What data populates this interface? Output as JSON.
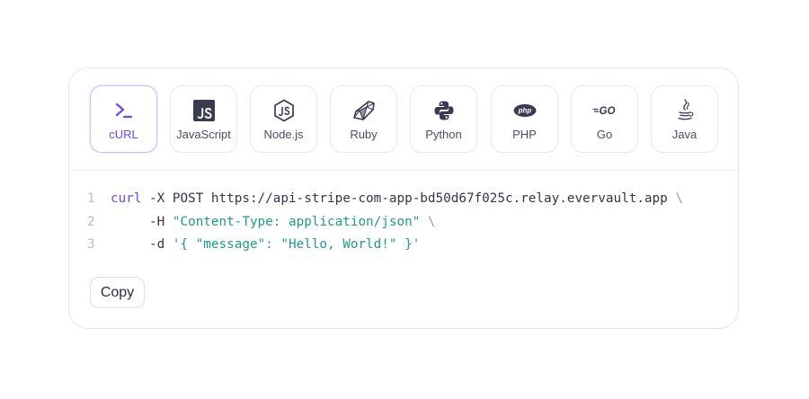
{
  "tabs": [
    {
      "label": "cURL",
      "icon": "terminal-icon",
      "active": true
    },
    {
      "label": "JavaScript",
      "icon": "javascript-icon",
      "active": false
    },
    {
      "label": "Node.js",
      "icon": "nodejs-icon",
      "active": false
    },
    {
      "label": "Ruby",
      "icon": "ruby-icon",
      "active": false
    },
    {
      "label": "Python",
      "icon": "python-icon",
      "active": false
    },
    {
      "label": "PHP",
      "icon": "php-icon",
      "active": false
    },
    {
      "label": "Go",
      "icon": "go-icon",
      "active": false
    },
    {
      "label": "Java",
      "icon": "java-icon",
      "active": false
    }
  ],
  "code": {
    "line1": {
      "num": "1",
      "cmd": "curl",
      "rest": " -X POST https://api-stripe-com-app-bd50d67f025c.relay.evervault.app",
      "cont": " \\"
    },
    "line2": {
      "num": "2",
      "flag": "     -H ",
      "str": "\"Content-Type: application/json\"",
      "cont": " \\"
    },
    "line3": {
      "num": "3",
      "flag": "     -d ",
      "str": "'{ \"message\": \"Hello, World!\" }'"
    }
  },
  "copy_button": {
    "label": "Copy"
  },
  "colors": {
    "accent": "#6c47ff",
    "string": "#1f9c85",
    "border": "#e6e5f2"
  }
}
